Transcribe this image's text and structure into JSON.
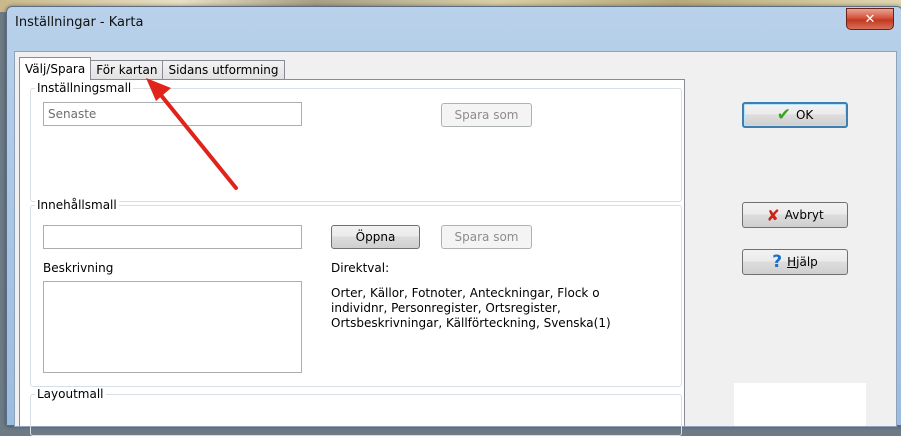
{
  "window": {
    "title": "Inställningar - Karta"
  },
  "tabs": [
    {
      "label": "Välj/Spara"
    },
    {
      "label": "För kartan"
    },
    {
      "label": "Sidans utformning"
    }
  ],
  "settings_template": {
    "label": "Inställningsmall",
    "input_value": "Senaste",
    "save_as_label": "Spara som"
  },
  "content_template": {
    "label": "Innehållsmall",
    "input_value": "",
    "open_label": "Öppna",
    "save_as_label": "Spara som",
    "description_label": "Beskrivning",
    "direct_choice_label": "Direktval:",
    "direct_choice_text": "Orter, Källor, Fotnoter, Anteckningar, Flock o individnr, Personregister, Ortsregister, Ortsbeskrivningar, Källförteckning, Svenska(1)"
  },
  "layout_template": {
    "label": "Layoutmall"
  },
  "buttons": {
    "ok": "OK",
    "cancel": "Avbryt",
    "help": "Hjälp",
    "help_accel": "H",
    "help_rest": "jälp"
  },
  "icons": {
    "ok": "check-icon",
    "cancel": "x-icon",
    "help": "question-icon",
    "close": "close-icon"
  },
  "colors": {
    "close_button": "#d5533c",
    "annotation_arrow": "#e0231b",
    "default_focus": "#3c7fb1"
  }
}
